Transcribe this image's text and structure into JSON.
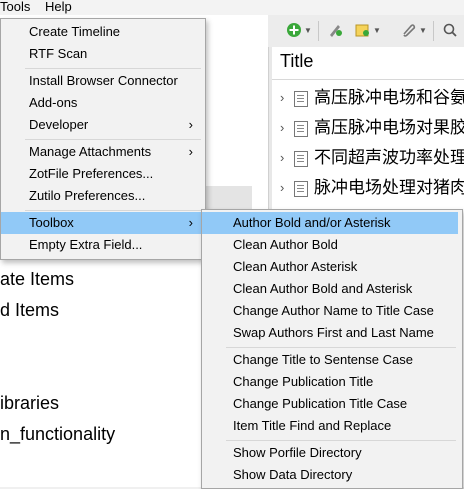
{
  "menubar": {
    "tools": "Tools",
    "help": "Help"
  },
  "toolbar": {
    "icons": [
      "new-item-icon",
      "add-by-identifier-icon",
      "new-note-icon",
      "attachment-icon",
      "search-icon"
    ]
  },
  "left_pane": {
    "rows": [
      "ate Items",
      "d Items",
      "ibraries",
      "n_functionality"
    ]
  },
  "items_pane": {
    "column_title": "Title",
    "rows": [
      "高压脉冲电场和谷氨",
      "高压脉冲电场对果胶",
      "不同超声波功率处理",
      "脉冲电场处理对猪肉"
    ]
  },
  "tools_menu": {
    "items": [
      "Create Timeline",
      "RTF Scan",
      "Install Browser Connector",
      "Add-ons",
      "Developer",
      "Manage Attachments",
      "ZotFile Preferences...",
      "Zutilo Preferences...",
      "Toolbox",
      "Empty Extra Field..."
    ]
  },
  "toolbox_submenu": {
    "items": [
      "Author Bold and/or Asterisk",
      "Clean Author Bold",
      "Clean Author Asterisk",
      "Clean Author Bold and Asterisk",
      "Change Author Name to Title Case",
      "Swap Authors First and Last Name",
      "Change Title to Sentense Case",
      "Change Publication Title",
      "Change Publication Title Case",
      "Item Title Find and Replace",
      "Show Porfile Directory",
      "Show Data Directory"
    ]
  },
  "colors": {
    "highlight": "#91c9f7",
    "menu_bg": "#f2f2f2"
  }
}
